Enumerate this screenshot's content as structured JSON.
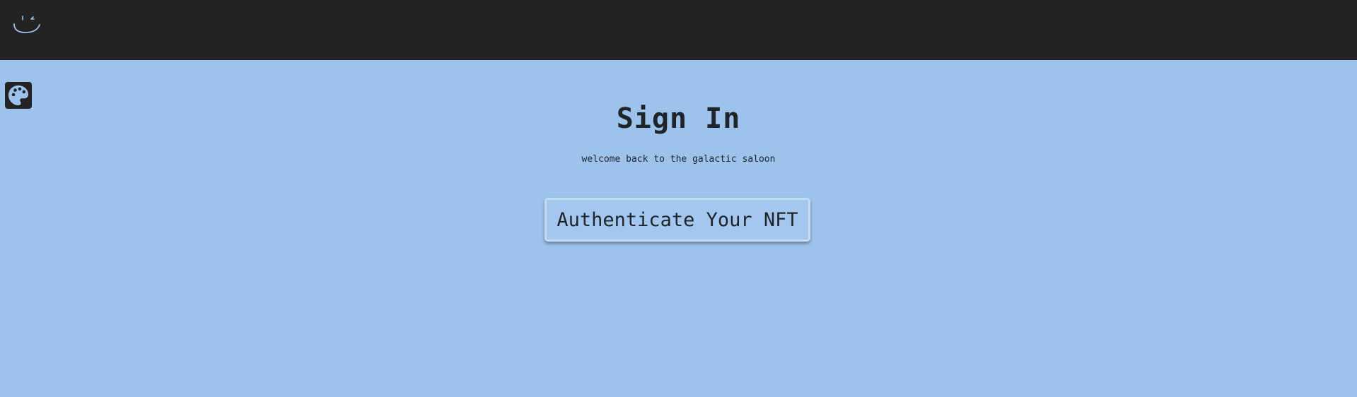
{
  "header": {
    "logo_icon": "winking-smiley-icon"
  },
  "toolbar": {
    "theme_icon": "palette-icon"
  },
  "main": {
    "title": "Sign In",
    "subtitle": "welcome back to the galactic saloon",
    "auth_button_label": "Authenticate Your NFT"
  },
  "colors": {
    "background": "#9dc3ec",
    "header": "#232323",
    "text": "#1f232a",
    "button_bg": "#a3c7ee",
    "button_border": "#c4dbf4"
  }
}
